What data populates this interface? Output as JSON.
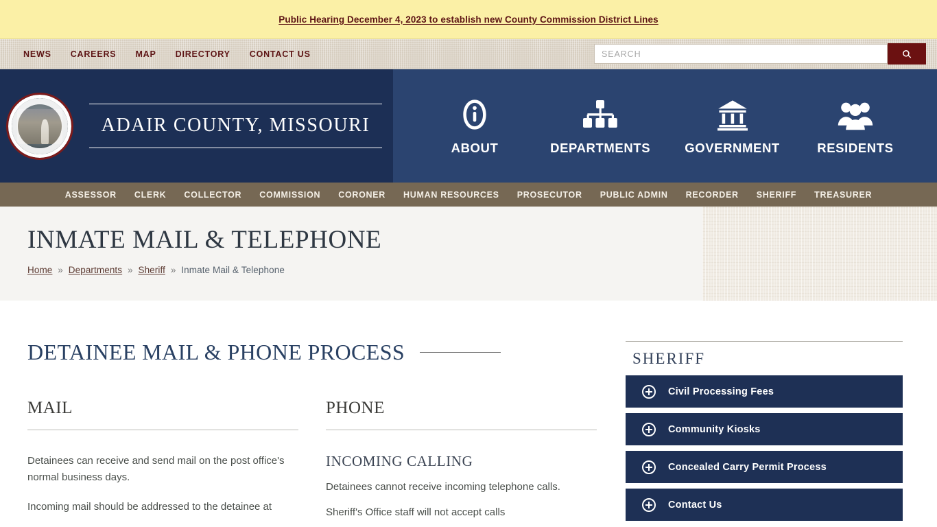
{
  "alert": {
    "text": "Public Hearing December 4, 2023 to establish new County Commission District Lines"
  },
  "utility": {
    "links": [
      {
        "label": "NEWS"
      },
      {
        "label": "CAREERS"
      },
      {
        "label": "MAP"
      },
      {
        "label": "DIRECTORY"
      },
      {
        "label": "CONTACT US"
      }
    ],
    "search_placeholder": "SEARCH",
    "search_value": "",
    "search_icon": "search-icon"
  },
  "masthead": {
    "seal_alt": "Adair County Missouri seal",
    "title": "ADAIR COUNTY, MISSOURI",
    "icon_nav": [
      {
        "label": "ABOUT",
        "icon": "info-circle-icon"
      },
      {
        "label": "DEPARTMENTS",
        "icon": "sitemap-icon"
      },
      {
        "label": "GOVERNMENT",
        "icon": "bank-icon"
      },
      {
        "label": "RESIDENTS",
        "icon": "users-icon"
      }
    ]
  },
  "dept_nav": [
    {
      "label": "ASSESSOR"
    },
    {
      "label": "CLERK"
    },
    {
      "label": "COLLECTOR"
    },
    {
      "label": "COMMISSION"
    },
    {
      "label": "CORONER"
    },
    {
      "label": "HUMAN RESOURCES"
    },
    {
      "label": "PROSECUTOR"
    },
    {
      "label": "PUBLIC ADMIN"
    },
    {
      "label": "RECORDER"
    },
    {
      "label": "SHERIFF"
    },
    {
      "label": "TREASURER"
    }
  ],
  "page": {
    "title": "INMATE MAIL & TELEPHONE",
    "breadcrumb": {
      "home": "Home",
      "departments": "Departments",
      "sheriff": "Sheriff",
      "separator": "»",
      "current": "Inmate Mail & Telephone"
    }
  },
  "content": {
    "section_heading": "DETAINEE MAIL & PHONE PROCESS",
    "mail": {
      "title": "MAIL",
      "p1": "Detainees can receive and send mail on the post office's normal business days.",
      "p2": "Incoming mail should be addressed to the detainee at"
    },
    "phone": {
      "title": "PHONE",
      "sub_title": "INCOMING CALLING",
      "p1": "Detainees cannot receive incoming telephone calls.",
      "p2": "Sheriff's Office staff will not accept calls"
    }
  },
  "sidebar": {
    "title": "SHERIFF",
    "items": [
      {
        "label": "Civil Processing Fees",
        "icon": "plus-circle-icon"
      },
      {
        "label": "Community Kiosks",
        "icon": "plus-circle-icon"
      },
      {
        "label": "Concealed Carry Permit Process",
        "icon": "plus-circle-icon"
      },
      {
        "label": "Contact Us",
        "icon": "plus-circle-icon"
      }
    ]
  },
  "colors": {
    "alert_bg": "#fbf0a6",
    "alert_text": "#5d1414",
    "utility_bg": "#d7cec0",
    "brand_navy_dark": "#1c2f55",
    "brand_navy_light": "#2b4470",
    "dept_nav_bg": "#766854",
    "accordion_bg": "#1e3055",
    "search_btn": "#6b1111",
    "heading_blue": "#2a4163"
  }
}
